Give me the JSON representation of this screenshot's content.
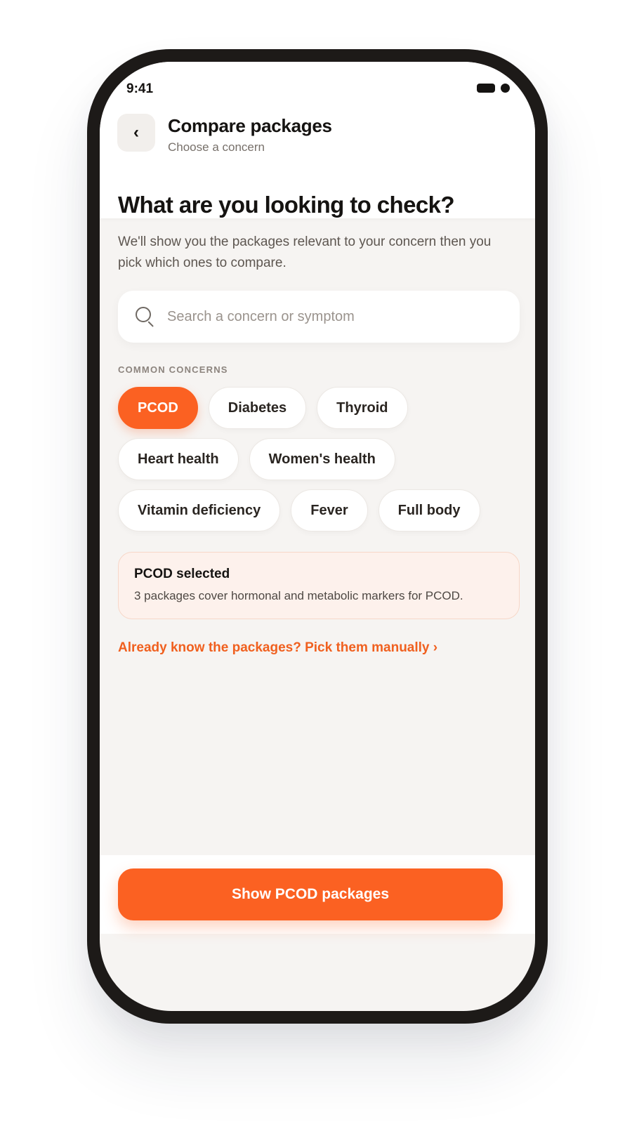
{
  "status_bar": {
    "time": "9:41"
  },
  "header": {
    "back_icon": "chevron-left-icon",
    "back_glyph": "‹",
    "title": "Compare packages",
    "subtitle": "Choose a concern"
  },
  "main": {
    "heading": "What are you looking to check?",
    "description": "We'll show you the packages relevant to your concern then you pick which ones to compare.",
    "search": {
      "icon": "search-icon",
      "placeholder": "Search a concern or symptom",
      "value": ""
    },
    "section_label": "COMMON CONCERNS",
    "chips": [
      {
        "label": "PCOD",
        "selected": true
      },
      {
        "label": "Diabetes",
        "selected": false
      },
      {
        "label": "Thyroid",
        "selected": false
      },
      {
        "label": "Heart health",
        "selected": false
      },
      {
        "label": "Women's health",
        "selected": false
      },
      {
        "label": "Vitamin deficiency",
        "selected": false
      },
      {
        "label": "Fever",
        "selected": false
      },
      {
        "label": "Full body",
        "selected": false
      }
    ],
    "selection_card": {
      "title": "PCOD selected",
      "body": "3 packages cover hormonal and metabolic markers for PCOD."
    },
    "manual_link": "Already know the packages? Pick them manually ›"
  },
  "footer": {
    "cta_label": "Show PCOD packages"
  },
  "colors": {
    "accent": "#fb6122",
    "background": "#f6f4f2",
    "card_tint": "#fdf1ec",
    "text_primary": "#151311"
  }
}
